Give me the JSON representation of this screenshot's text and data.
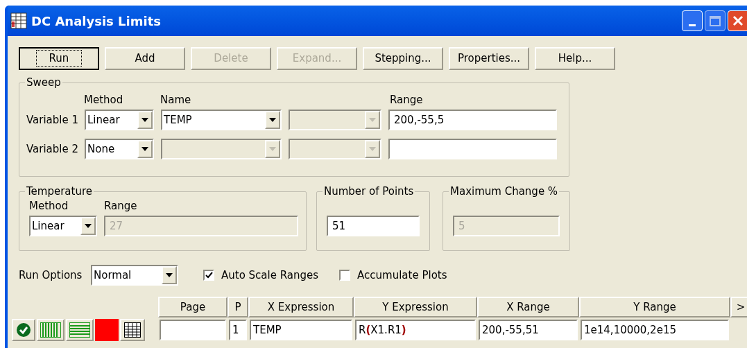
{
  "window": {
    "title": "DC Analysis Limits"
  },
  "buttons": [
    {
      "label": "Run",
      "disabled": false,
      "focused": true
    },
    {
      "label": "Add",
      "disabled": false,
      "focused": false
    },
    {
      "label": "Delete",
      "disabled": true,
      "focused": false
    },
    {
      "label": "Expand...",
      "disabled": true,
      "focused": false
    },
    {
      "label": "Stepping...",
      "disabled": false,
      "focused": false
    },
    {
      "label": "Properties...",
      "disabled": false,
      "focused": false
    },
    {
      "label": "Help...",
      "disabled": false,
      "focused": false
    }
  ],
  "sweep": {
    "title": "Sweep",
    "headers": [
      "Method",
      "Name",
      "Range"
    ],
    "variables": [
      {
        "label": "Variable 1",
        "method": "Linear",
        "name": "TEMP",
        "name_disabled": false,
        "range": "200,-55,5"
      },
      {
        "label": "Variable 2",
        "method": "None",
        "name_disabled": true
      }
    ]
  },
  "temperature": {
    "title": "Temperature",
    "method_label": "Method",
    "range_label": "Range",
    "method": "Linear",
    "range": "27",
    "range_disabled": true
  },
  "points": {
    "title": "Number of Points",
    "value": "51"
  },
  "max_change": {
    "title": "Maximum Change %",
    "value": "5",
    "disabled": true
  },
  "run_options": {
    "label": "Run Options",
    "value": "Normal"
  },
  "checkboxes": [
    {
      "label": "Auto Scale Ranges",
      "checked": true
    },
    {
      "label": "Accumulate Plots",
      "checked": false
    }
  ],
  "table": {
    "columns": [
      "Page",
      "P",
      "X Expression",
      "Y Expression",
      "X Range",
      "Y Range",
      ">"
    ],
    "rows": [
      {
        "p": "1",
        "x_expression": "TEMP",
        "y_expression": "R**(**X1.R1**)**",
        "x_range": "200,-55,51",
        "y_range": "1e14,10000,2e15"
      }
    ]
  }
}
